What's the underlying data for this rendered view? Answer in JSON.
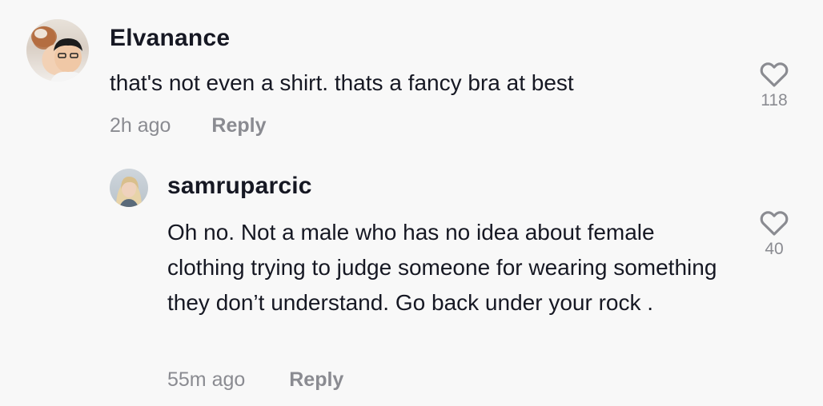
{
  "comments": [
    {
      "username": "Elvanance",
      "text": "that's not even a shirt. thats a fancy bra at best",
      "time": "2h ago",
      "reply_label": "Reply",
      "likes": "118"
    }
  ],
  "replies": [
    {
      "username": "samruparcic",
      "text": "Oh no. Not a male who has no idea about female clothing trying to judge someone for wearing something they don’t understand. Go back under your rock .",
      "time": "55m ago",
      "reply_label": "Reply",
      "likes": "40"
    }
  ],
  "icons": {
    "like": "heart-outline-icon"
  },
  "colors": {
    "background": "#f8f8f8",
    "text": "#161823",
    "muted": "#8a8b91"
  }
}
